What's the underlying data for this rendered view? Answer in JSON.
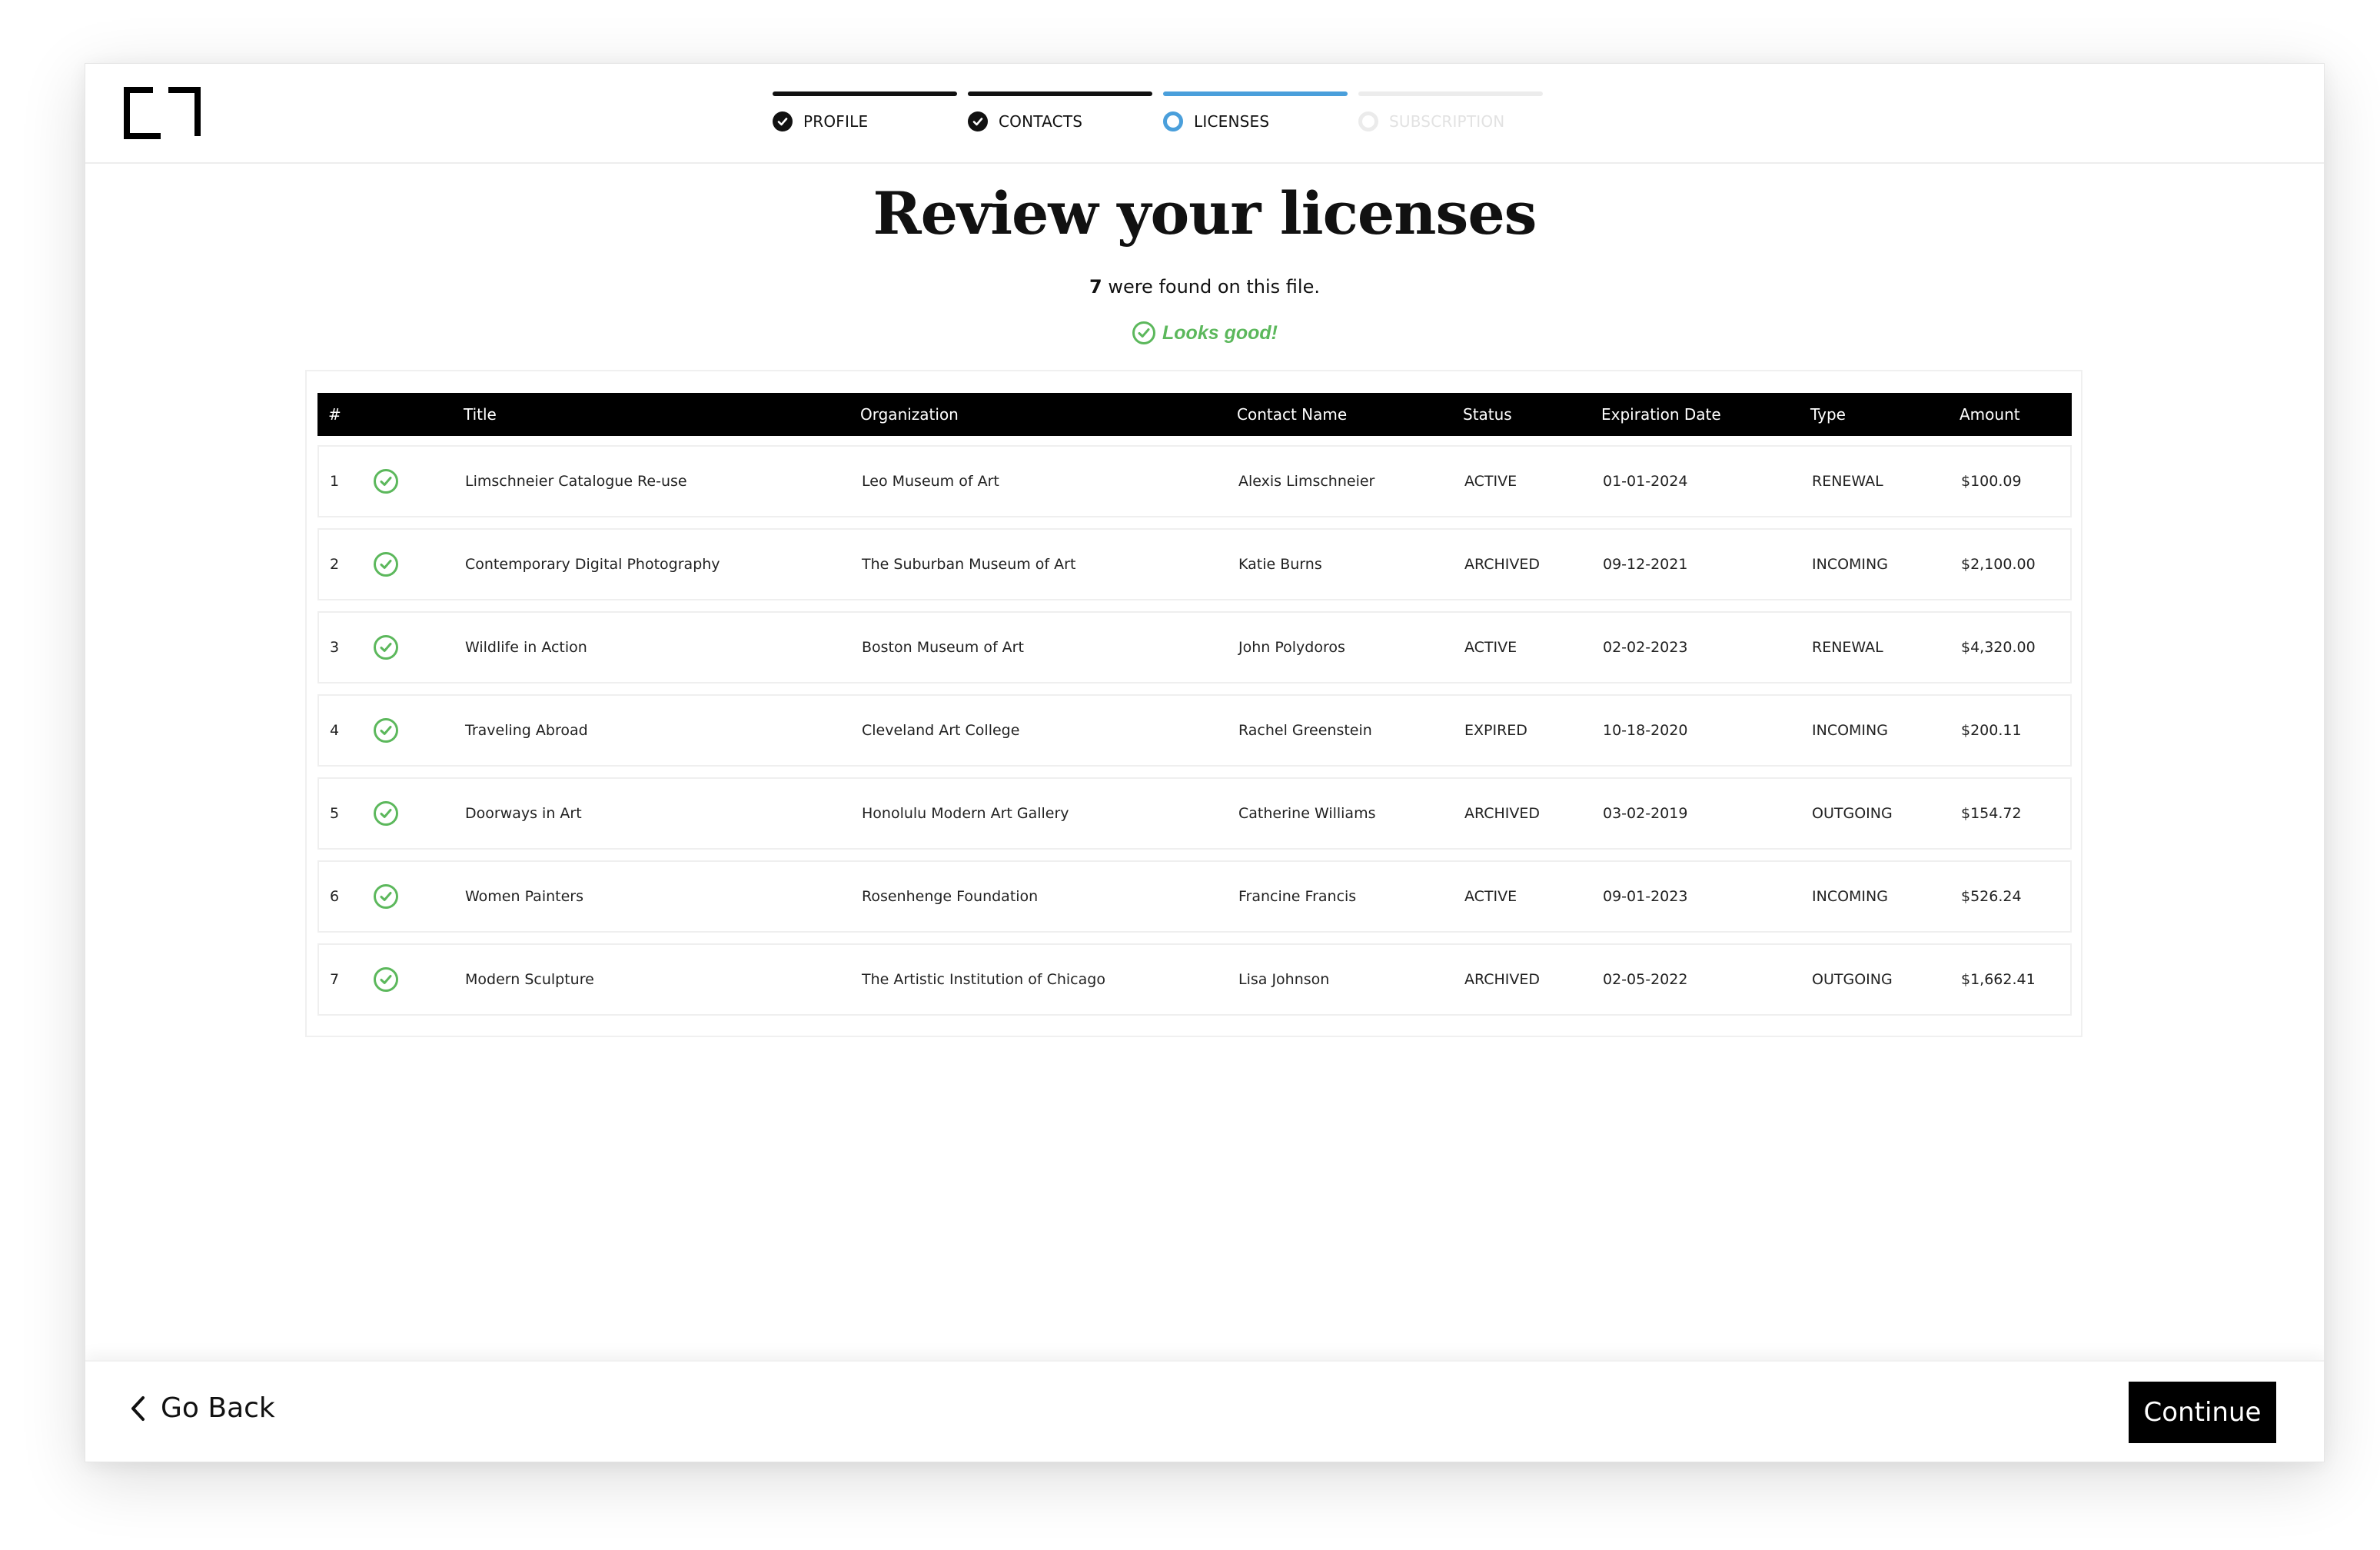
{
  "stepper": {
    "steps": [
      {
        "label": "PROFILE",
        "state": "done"
      },
      {
        "label": "CONTACTS",
        "state": "done"
      },
      {
        "label": "LICENSES",
        "state": "active"
      },
      {
        "label": "SUBSCRIPTION",
        "state": "pending"
      }
    ]
  },
  "page": {
    "title": "Review your licenses",
    "found_count": "7",
    "found_suffix": " were found on this file.",
    "status_text": "Looks good!"
  },
  "table": {
    "headers": {
      "num": "#",
      "title": "Title",
      "organization": "Organization",
      "contact": "Contact Name",
      "status": "Status",
      "expiration": "Expiration Date",
      "type": "Type",
      "amount": "Amount"
    },
    "rows": [
      {
        "num": "1",
        "title": "Limschneier Catalogue Re-use",
        "organization": "Leo Museum of Art",
        "contact": "Alexis Limschneier",
        "status": "ACTIVE",
        "expiration": "01-01-2024",
        "type": "RENEWAL",
        "amount": "$100.09"
      },
      {
        "num": "2",
        "title": "Contemporary Digital Photography",
        "organization": "The Suburban Museum of Art",
        "contact": "Katie Burns",
        "status": "ARCHIVED",
        "expiration": "09-12-2021",
        "type": "INCOMING",
        "amount": "$2,100.00"
      },
      {
        "num": "3",
        "title": "Wildlife in Action",
        "organization": "Boston Museum of Art",
        "contact": "John Polydoros",
        "status": "ACTIVE",
        "expiration": "02-02-2023",
        "type": "RENEWAL",
        "amount": "$4,320.00"
      },
      {
        "num": "4",
        "title": "Traveling Abroad",
        "organization": "Cleveland Art College",
        "contact": "Rachel Greenstein",
        "status": "EXPIRED",
        "expiration": "10-18-2020",
        "type": "INCOMING",
        "amount": "$200.11"
      },
      {
        "num": "5",
        "title": "Doorways in Art",
        "organization": "Honolulu Modern Art Gallery",
        "contact": "Catherine Williams",
        "status": "ARCHIVED",
        "expiration": "03-02-2019",
        "type": "OUTGOING",
        "amount": "$154.72"
      },
      {
        "num": "6",
        "title": "Women Painters",
        "organization": "Rosenhenge Foundation",
        "contact": "Francine Francis",
        "status": "ACTIVE",
        "expiration": "09-01-2023",
        "type": "INCOMING",
        "amount": "$526.24"
      },
      {
        "num": "7",
        "title": "Modern Sculpture",
        "organization": "The Artistic Institution of Chicago",
        "contact": "Lisa Johnson",
        "status": "ARCHIVED",
        "expiration": "02-05-2022",
        "type": "OUTGOING",
        "amount": "$1,662.41"
      }
    ]
  },
  "footer": {
    "back_label": "Go Back",
    "continue_label": "Continue"
  },
  "icons": {
    "logo": "brand-logo",
    "done": "check-circle-icon",
    "row_status": "check-circle-outline-icon",
    "back": "chevron-left-icon"
  },
  "colors": {
    "accent": "#4a9fdb",
    "success": "#5cb85c",
    "dark": "#000000"
  }
}
